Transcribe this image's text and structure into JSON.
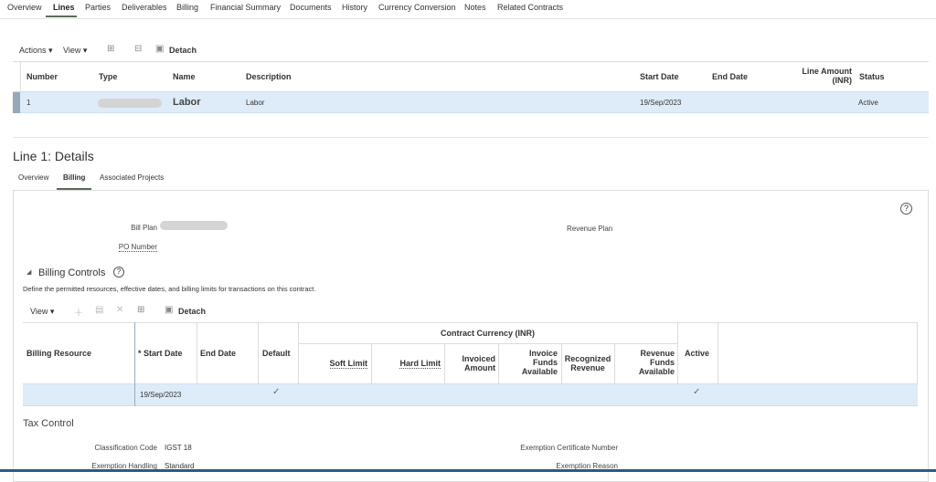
{
  "tabs": [
    "Overview",
    "Lines",
    "Parties",
    "Deliverables",
    "Billing",
    "Financial Summary",
    "Documents",
    "History",
    "Currency Conversion",
    "Notes",
    "Related Contracts"
  ],
  "lines_toolbar": {
    "actions": "Actions",
    "view": "View",
    "detach": "Detach"
  },
  "lines_table": {
    "headers": {
      "number": "Number",
      "type": "Type",
      "name": "Name",
      "description": "Description",
      "start_date": "Start Date",
      "end_date": "End Date",
      "line_amount": "Line Amount",
      "line_amount_unit": "(INR)",
      "status": "Status"
    },
    "rows": [
      {
        "number": "1",
        "name": "Labor",
        "description": "Labor",
        "start_date": "19/Sep/2023",
        "status": "Active"
      }
    ]
  },
  "details": {
    "title": "Line 1: Details",
    "subtabs": [
      "Overview",
      "Billing",
      "Associated Projects"
    ],
    "bill_plan": "Bill Plan",
    "revenue_plan": "Revenue Plan",
    "po_number": "PO Number",
    "billing_controls": {
      "title": "Billing Controls",
      "description": "Define the permitted resources, effective dates, and billing limits for transactions on this contract.",
      "toolbar": {
        "view": "View",
        "detach": "Detach"
      },
      "headers": {
        "billing_resource": "Billing Resource",
        "required": "*",
        "start_date": "Start Date",
        "end_date": "End Date",
        "default": "Default",
        "group": "Contract Currency (INR)",
        "soft_limit": "Soft Limit",
        "hard_limit": "Hard Limit",
        "invoiced1": "Invoiced",
        "invoiced2": "Amount",
        "inv_funds1": "Invoice",
        "inv_funds2": "Funds",
        "inv_funds3": "Available",
        "rec1": "Recognized",
        "rec2": "Revenue",
        "rev1": "Revenue",
        "rev2": "Funds",
        "rev3": "Available",
        "active": "Active"
      },
      "rows": [
        {
          "start_date": "19/Sep/2023",
          "default": "✓",
          "active": "✓"
        }
      ]
    },
    "tax_control": {
      "title": "Tax Control",
      "classification_code_label": "Classification Code",
      "classification_code": "IGST 18",
      "exemption_handling_label": "Exemption Handling",
      "exemption_handling": "Standard",
      "exemption_cert_label": "Exemption Certificate Number",
      "exemption_reason_label": "Exemption Reason"
    }
  }
}
